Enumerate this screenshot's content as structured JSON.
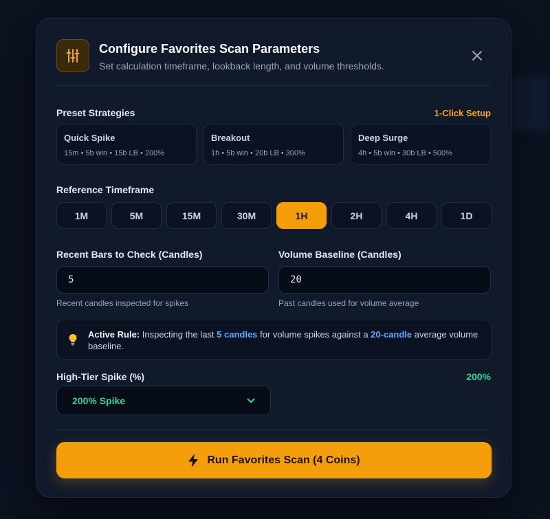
{
  "header": {
    "title": "Configure Favorites Scan Parameters",
    "subtitle": "Set calculation timeframe, lookback length, and volume thresholds.",
    "icon": "sliders-icon"
  },
  "presets": {
    "label": "Preset Strategies",
    "badge": "1-Click Setup",
    "items": [
      {
        "name": "Quick Spike",
        "desc": "15m • 5b win • 15b LB • 200%"
      },
      {
        "name": "Breakout",
        "desc": "1h • 5b win • 20b LB • 300%"
      },
      {
        "name": "Deep Surge",
        "desc": "4h • 5b win • 30b LB • 500%"
      }
    ]
  },
  "timeframe": {
    "label": "Reference Timeframe",
    "options": [
      "1M",
      "5M",
      "15M",
      "30M",
      "1H",
      "2H",
      "4H",
      "1D"
    ],
    "selected": "1H"
  },
  "recent_bars": {
    "label": "Recent Bars to Check (Candles)",
    "value": "5",
    "hint": "Recent candles inspected for spikes"
  },
  "volume_baseline": {
    "label": "Volume Baseline (Candles)",
    "value": "20",
    "hint": "Past candles used for volume average"
  },
  "rule": {
    "title": "Active Rule:",
    "text_1": " Inspecting the last ",
    "hl_1": "5 candles",
    "text_2": " for volume spikes against a ",
    "hl_2": "20-candle",
    "text_3": " average volume baseline."
  },
  "spike": {
    "label": "High-Tier Spike (%)",
    "readout": "200%",
    "selected": "200% Spike"
  },
  "run_button": {
    "label": "Run Favorites Scan (4 Coins)"
  },
  "colors": {
    "accent": "#f59e0b",
    "highlight": "#60a5fa",
    "success": "#34d399"
  }
}
